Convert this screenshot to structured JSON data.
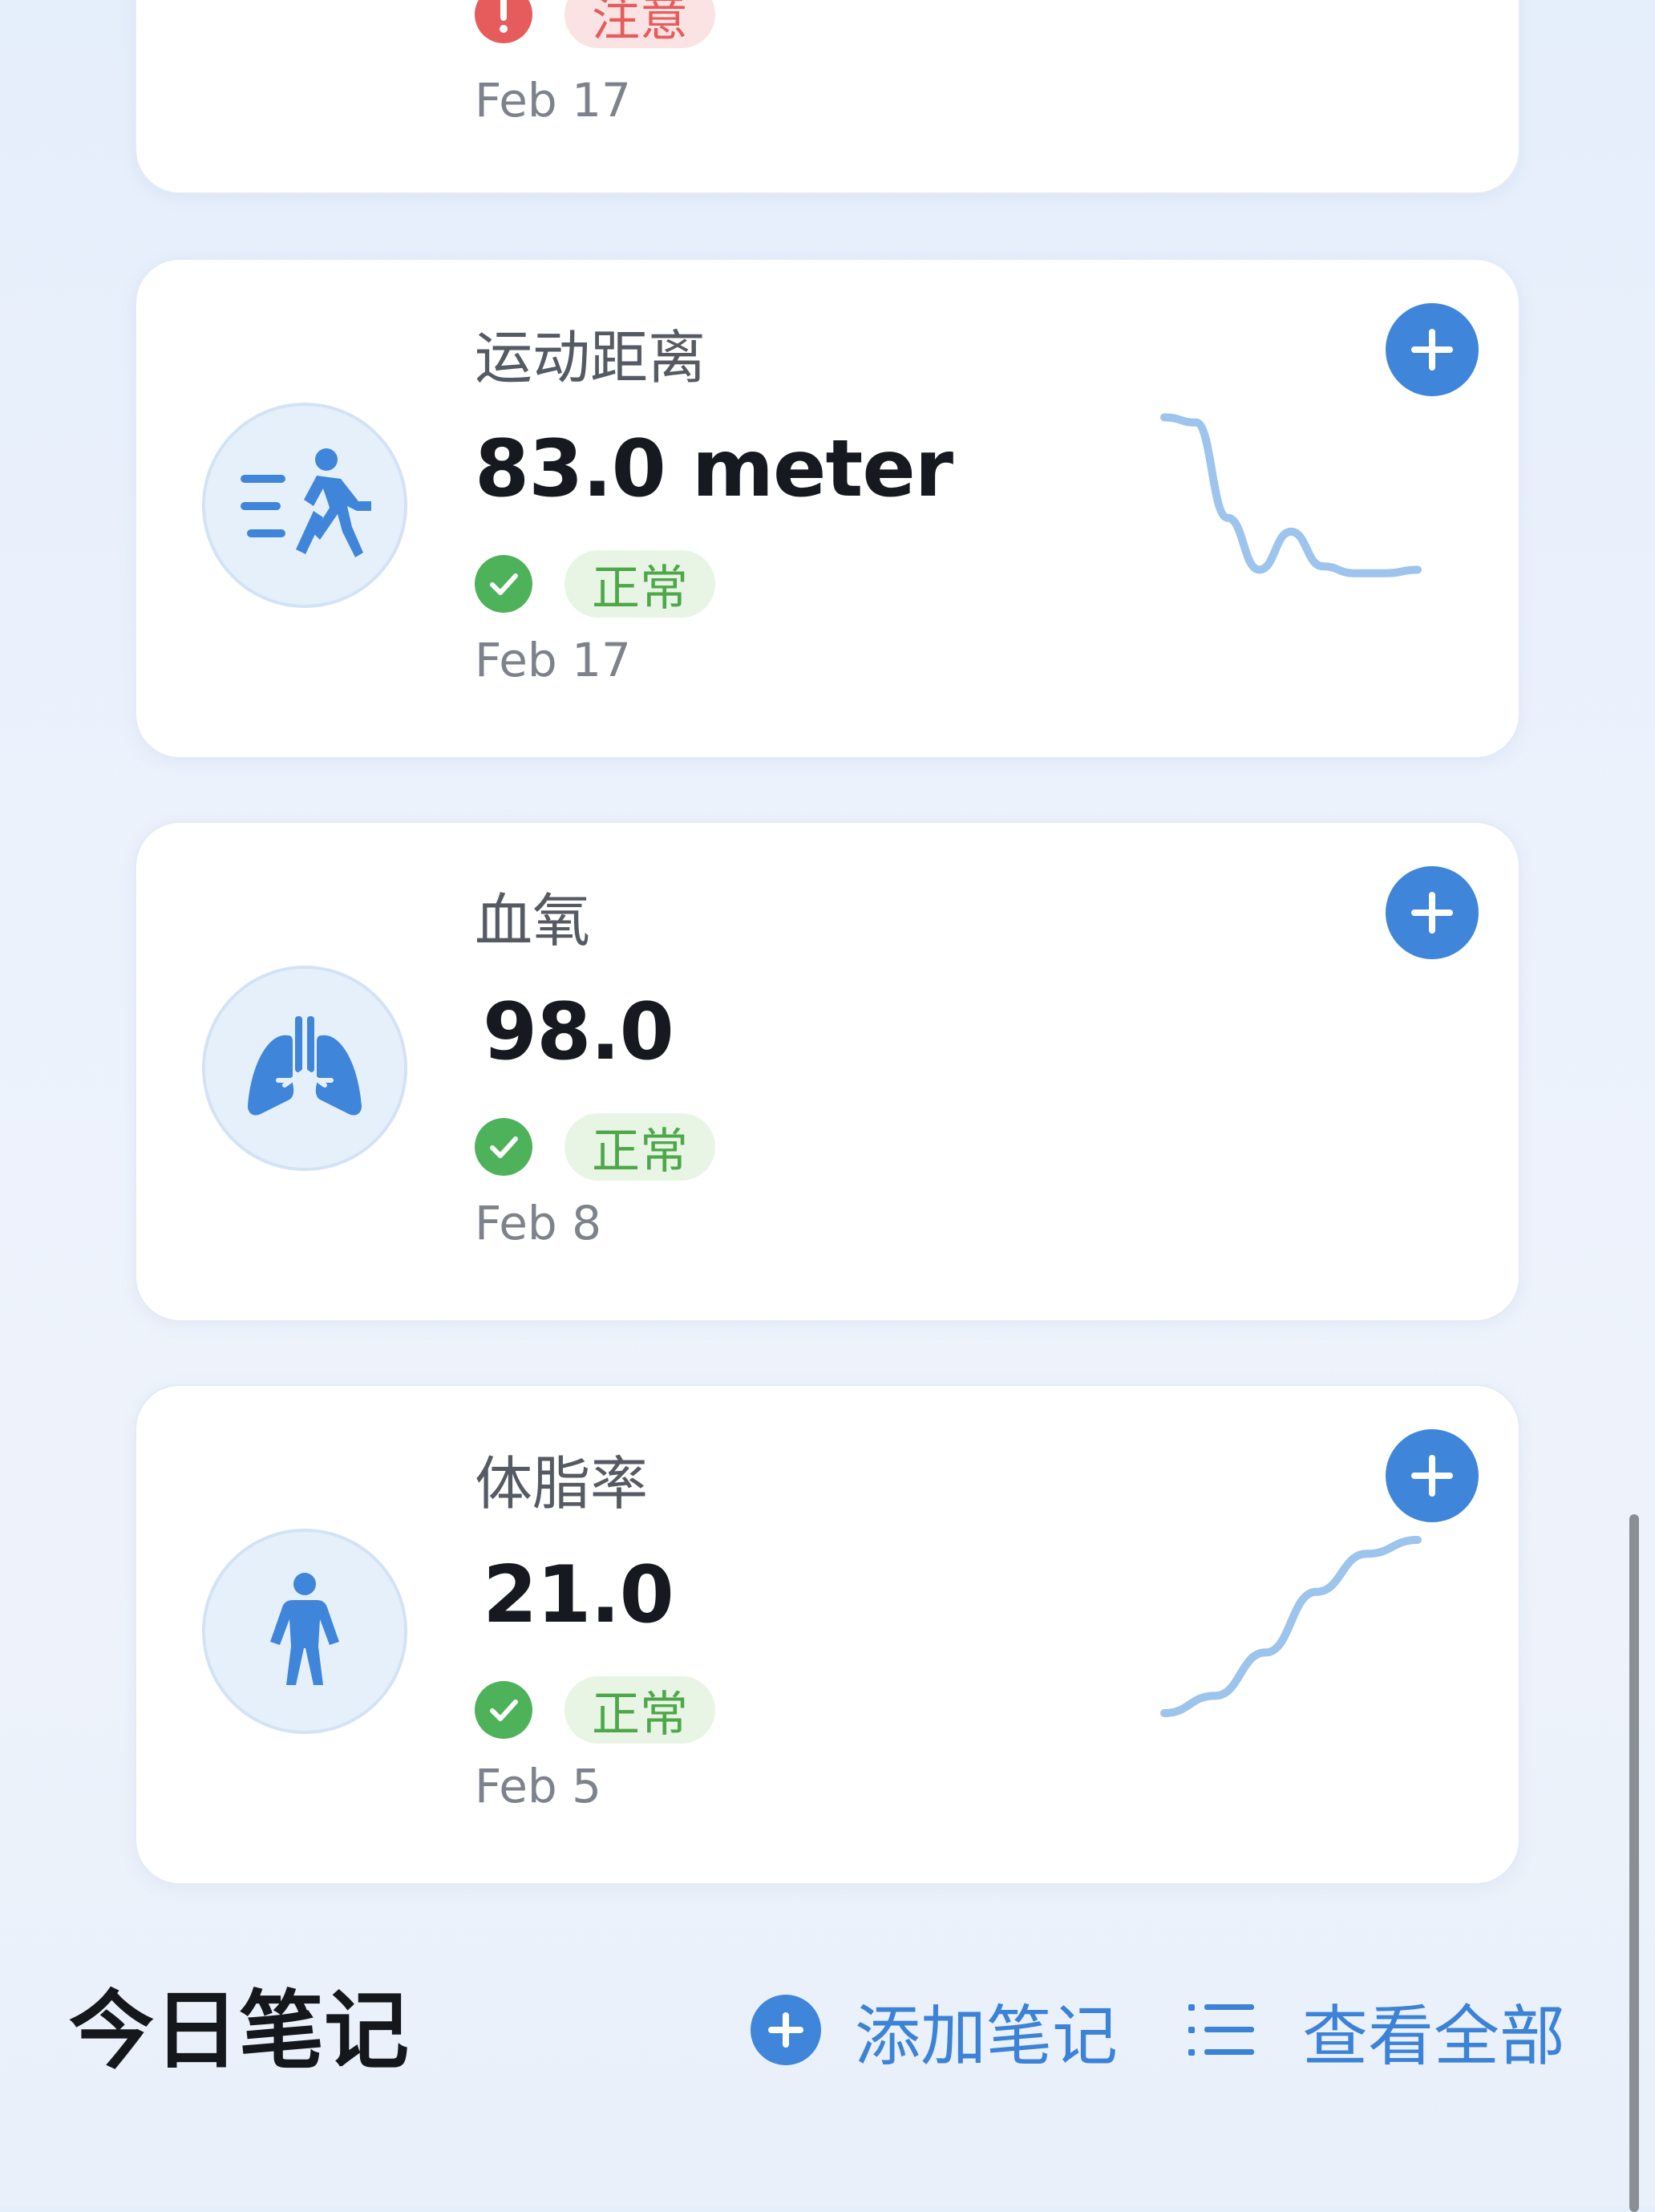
{
  "top_card": {
    "status_label": "注意",
    "date": "Feb 17"
  },
  "cards": [
    {
      "title": "运动距离",
      "value": "83.0 meter",
      "status_label": "正常",
      "date": "Feb 17",
      "icon": "walking-person-icon",
      "trend": [
        0.98,
        0.95,
        0.4,
        0.1,
        0.32,
        0.12,
        0.08,
        0.08,
        0.1
      ]
    },
    {
      "title": "血氧",
      "value": "98.0",
      "status_label": "正常",
      "date": "Feb 8",
      "icon": "lungs-icon"
    },
    {
      "title": "体脂率",
      "value": "21.0",
      "status_label": "正常",
      "date": "Feb 5",
      "icon": "person-icon",
      "trend": [
        0.0,
        0.1,
        0.35,
        0.7,
        0.92,
        1.0
      ]
    }
  ],
  "notes": {
    "title": "今日笔记",
    "add_label": "添加笔记",
    "view_all_label": "查看全部"
  },
  "colors": {
    "accent": "#3f86db",
    "normal": "#4ea84a",
    "warning": "#e65b5b",
    "trend_line": "#9dc4ec"
  }
}
